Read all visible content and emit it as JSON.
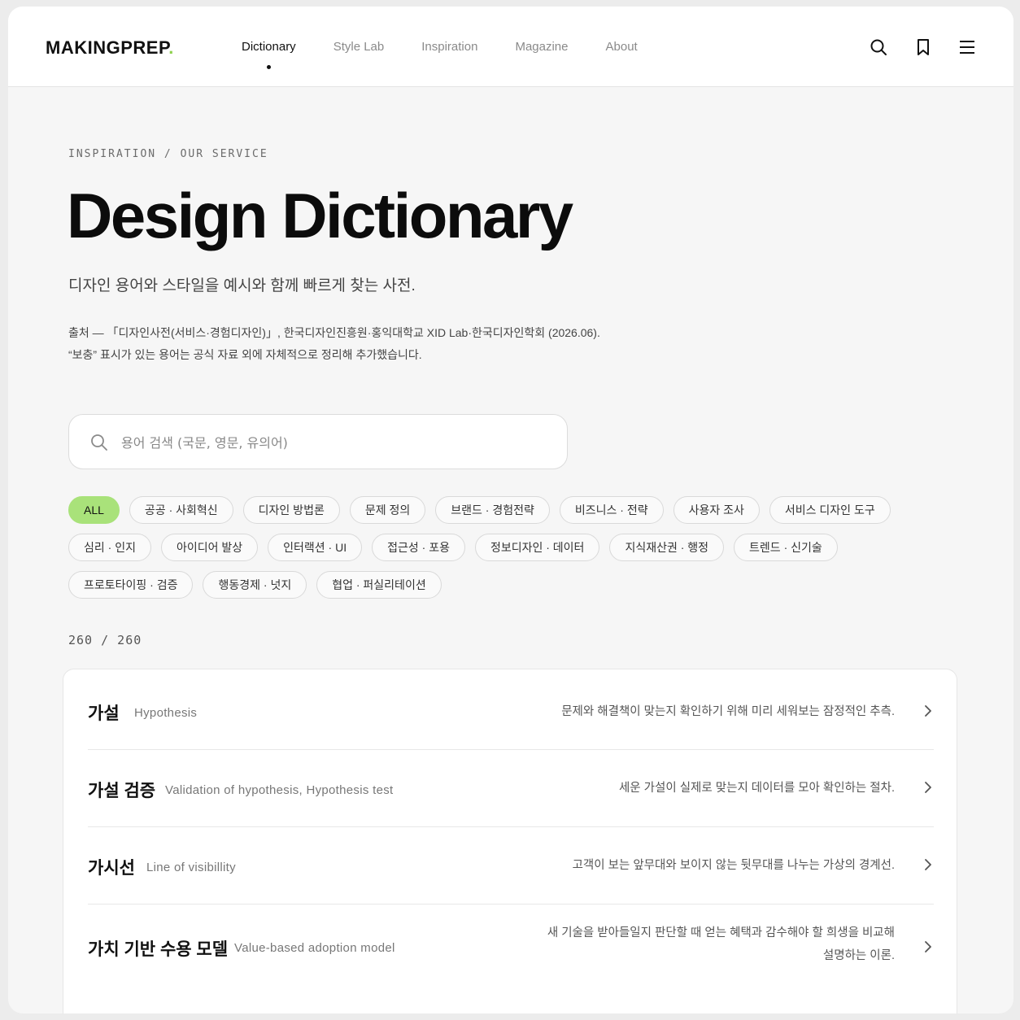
{
  "header": {
    "logo": "MAKINGPREP",
    "logo_dot": ".",
    "nav": [
      "Dictionary",
      "Style Lab",
      "Inspiration",
      "Magazine",
      "About"
    ],
    "icons": [
      "search-icon",
      "bookmark-icon",
      "menu-icon"
    ]
  },
  "hero": {
    "breadcrumb": "INSPIRATION / OUR SERVICE",
    "title": "Design Dictionary",
    "subtitle": "디자인 용어와 스타일을 예시와 함께 빠르게 찾는 사전.",
    "source_line1": "출처 — 「디자인사전(서비스·경험디자인)」, 한국디자인진흥원·홍익대학교 XID Lab·한국디자인학회 (2026.06).",
    "source_line2": "“보충” 표시가 있는 용어는 공식 자료 외에 자체적으로 정리해 추가했습니다."
  },
  "search": {
    "placeholder": "용어 검색 (국문, 영문, 유의어)"
  },
  "filters": [
    "ALL",
    "공공 · 사회혁신",
    "디자인 방법론",
    "문제 정의",
    "브랜드 · 경험전략",
    "비즈니스 · 전략",
    "사용자 조사",
    "서비스 디자인 도구",
    "심리 · 인지",
    "아이디어 발상",
    "인터랙션 · UI",
    "접근성 · 포용",
    "정보디자인 · 데이터",
    "지식재산권 · 행정",
    "트렌드 · 신기술",
    "프로토타이핑 · 검증",
    "행동경제 · 넛지",
    "협업 · 퍼실리테이션"
  ],
  "active_filter": "ALL",
  "count": "260  /  260",
  "terms": [
    {
      "term": "가설",
      "en": "Hypothesis",
      "definition": "문제와 해결책이 맞는지 확인하기 위해 미리 세워보는 잠정적인 추측."
    },
    {
      "term": "가설 검증",
      "en": "Validation of hypothesis, Hypothesis test",
      "definition": "세운 가설이 실제로 맞는지 데이터를 모아 확인하는 절차."
    },
    {
      "term": "가시선",
      "en": "Line of visibillity",
      "definition": "고객이 보는 앞무대와 보이지 않는 뒷무대를 나누는 가상의 경계선."
    },
    {
      "term": "가치 기반 수용 모델",
      "en": "Value-based adoption model",
      "definition": "새 기술을 받아들일지 판단할 때 얻는 혜택과 감수해야 할 희생을 비교해 설명하는 이론."
    }
  ],
  "colors": {
    "accent": "#a9e27a",
    "logo_dot": "#8fd14f",
    "background": "#f6f6f6"
  }
}
